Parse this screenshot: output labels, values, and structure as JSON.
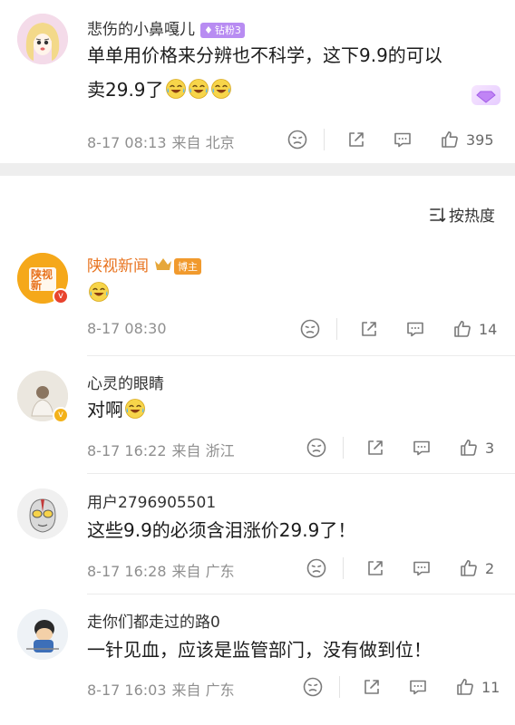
{
  "top_comment": {
    "username": "悲伤的小鼻嘎儿",
    "badge": "钻粉3",
    "text_line1": "单单用价格来分辨也不科学，这下9.9的可以",
    "text_line2": "卖29.9了",
    "time": "8-17 08:13",
    "location": "来自 北京",
    "likes": "395"
  },
  "sort": {
    "label": "按热度"
  },
  "comments": [
    {
      "username": "陕视新闻",
      "badge": "博主",
      "time": "8-17 08:30",
      "location": "",
      "likes": "14",
      "avatar_text": "陕视新"
    },
    {
      "username": "心灵的眼睛",
      "text": "对啊",
      "time": "8-17 16:22",
      "location": "来自 浙江",
      "likes": "3"
    },
    {
      "username": "用户2796905501",
      "text": "这些9.9的必须含泪涨价29.9了！",
      "time": "8-17 16:28",
      "location": "来自 广东",
      "likes": "2"
    },
    {
      "username": "走你们都走过的路0",
      "text": "一针见血，应该是监管部门，没有做到位！",
      "time": "8-17 16:03",
      "location": "来自 广东",
      "likes": "11"
    }
  ],
  "colors": {
    "orange_name": "#e8731f",
    "meta_gray": "#8f8f8f",
    "divider": "#eeeeee",
    "badge_purple": "#b88cf2",
    "badge_orange": "#f19a2d"
  }
}
